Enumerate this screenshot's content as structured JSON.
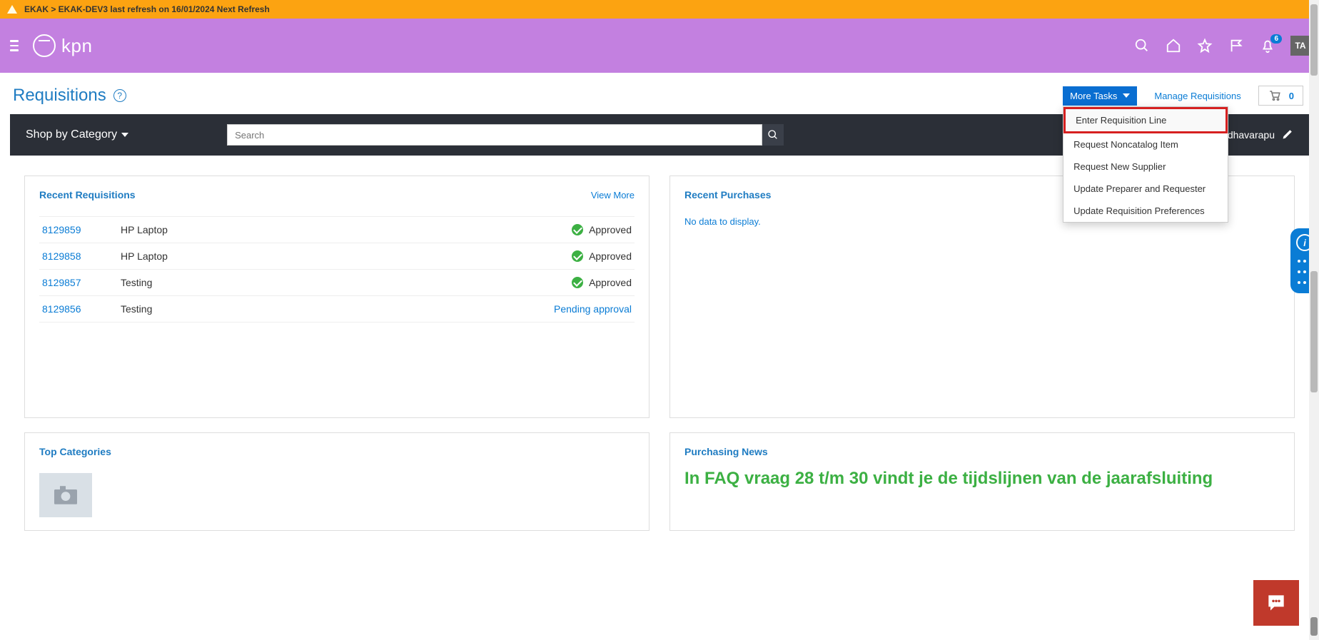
{
  "banner": {
    "text": "EKAK > EKAK-DEV3 last refresh on 16/01/2024 Next Refresh"
  },
  "brand": {
    "name": "kpn"
  },
  "header": {
    "notification_count": "6",
    "avatar_initials": "TA"
  },
  "page": {
    "title": "Requisitions",
    "more_tasks_label": "More Tasks",
    "manage_link": "Manage Requisitions",
    "cart_count": "0"
  },
  "more_tasks_menu": {
    "items": [
      "Enter Requisition Line",
      "Request Noncatalog Item",
      "Request New Supplier",
      "Update Preparer and Requester",
      "Update Requisition Preferences"
    ]
  },
  "shop_bar": {
    "category_label": "Shop by Category",
    "search_placeholder": "Search",
    "user_name": "Prabhu Andhavarapu"
  },
  "recent_requisitions": {
    "title": "Recent Requisitions",
    "view_more": "View More",
    "rows": [
      {
        "id": "8129859",
        "desc": "HP Laptop",
        "status": "Approved",
        "approved": true
      },
      {
        "id": "8129858",
        "desc": "HP Laptop",
        "status": "Approved",
        "approved": true
      },
      {
        "id": "8129857",
        "desc": "Testing",
        "status": "Approved",
        "approved": true
      },
      {
        "id": "8129856",
        "desc": "Testing",
        "status": "Pending approval",
        "approved": false
      }
    ]
  },
  "recent_purchases": {
    "title": "Recent Purchases",
    "empty_text": "No data to display."
  },
  "top_categories": {
    "title": "Top Categories"
  },
  "purchasing_news": {
    "title": "Purchasing News",
    "headline": "In FAQ vraag 28 t/m 30 vindt je de tijdslijnen van de jaarafsluiting"
  }
}
